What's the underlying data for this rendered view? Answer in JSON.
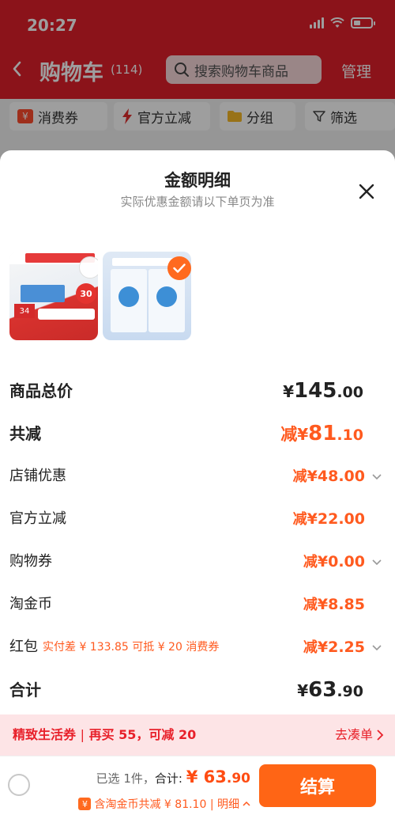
{
  "status_bar": {
    "time": "20:27"
  },
  "header": {
    "title": "购物车",
    "count": "(114)",
    "search_placeholder": "搜索购物车商品",
    "manage_label": "管理"
  },
  "filters": [
    {
      "label": "消费券",
      "icon": "coupon-icon"
    },
    {
      "label": "官方立减",
      "icon": "lightning-icon"
    },
    {
      "label": "分组",
      "icon": "folder-icon"
    },
    {
      "label": "筛选",
      "icon": "filter-icon"
    }
  ],
  "sheet": {
    "title": "金额明细",
    "subtitle": "实际优惠金额请以下单页为准",
    "products": [
      {
        "selected": false,
        "badge_price": "34",
        "badge_30": "30"
      },
      {
        "selected": true
      }
    ],
    "rows": {
      "goods_total": {
        "label": "商品总价",
        "yen": "¥",
        "int": "145",
        "dec": ".00"
      },
      "total_reduce": {
        "label": "共减",
        "prefix": "减",
        "yen": "¥",
        "int": "81",
        "dec": ".10"
      },
      "shop_discount": {
        "label": "店铺优惠",
        "prefix": "减",
        "value": "¥48.00"
      },
      "official_reduce": {
        "label": "官方立减",
        "prefix": "减",
        "value": "¥22.00"
      },
      "shopping_coupon": {
        "label": "购物券",
        "prefix": "减",
        "value": "¥0.00"
      },
      "taojinbi": {
        "label": "淘金币",
        "prefix": "减",
        "value": "¥8.85"
      },
      "hongbao": {
        "label": "红包",
        "note": "实付差 ¥ 133.85 可抵 ¥ 20 消费券",
        "prefix": "减",
        "value": "¥2.25"
      },
      "subtotal": {
        "label": "合计",
        "yen": "¥",
        "int": "63",
        "dec": ".90"
      }
    },
    "coupon_bar": {
      "title": "精致生活券",
      "sep": "|",
      "text": "再买 55，可减 20",
      "action": "去凑单"
    }
  },
  "bottom": {
    "selected_text": "已选 1件，",
    "total_label": "合计:",
    "total_yen": "¥",
    "total_int": "63",
    "total_dec": ".90",
    "sub_text": "含淘金币共减 ¥ 81.10 | 明细",
    "checkout_label": "结算"
  },
  "colors": {
    "brand_red": "#e0202b",
    "accent_orange": "#ff5a1f",
    "checkout_orange": "#ff6515",
    "coupon_bg": "#fde4e6"
  }
}
